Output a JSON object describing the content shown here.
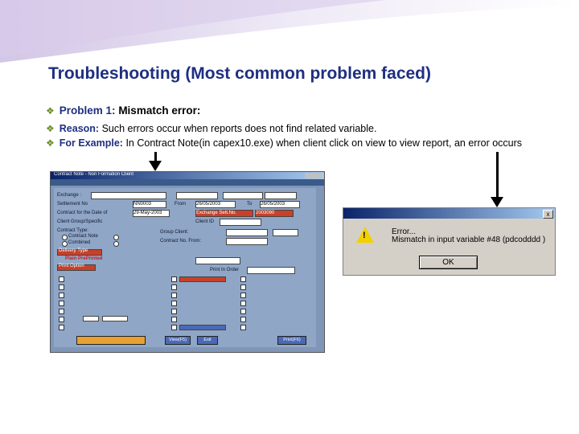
{
  "slide": {
    "title": "Troubleshooting (Most common problem faced)",
    "bullets": {
      "b1_label": "Problem 1:",
      "b1_text": "Mismatch error:",
      "b2_label": "Reason:",
      "b2_text": "Such errors occur when reports does not find related variable.",
      "b3_label": "For Example:",
      "b3_text": "In Contract Note(in capex10.exe) when client click on view to view report, an error occurs"
    }
  },
  "app_window": {
    "title": "Contract Note - Non Formation Client",
    "settlement_no": "NN0003",
    "date_from": "29-May-2003",
    "date_range_from": "26/05/2003",
    "date_range_to": "26/05/2003",
    "exchange_sett": "Exchange Sett.No.",
    "exchange_sett_value": "2003090",
    "labels": {
      "exchange": "Exchange :",
      "settlement": "Settlement No",
      "contract_date": "Contract for the Date of",
      "client_group": "Client Group/Specific",
      "contract_type": "Contract Type:",
      "group_client": "Group Client:",
      "contract_no_from": "Contract No. From:",
      "delivery_type": "Delivery Type",
      "print_option": "Print Option",
      "plain": "Plain",
      "preprinted": "PrePrinted",
      "range": "Range",
      "from": "From",
      "to": "To",
      "client_id": "Client ID",
      "contract_note": "Contract Note",
      "combined": "Combined",
      "order": "Order",
      "print_in_order": "Print In Order"
    },
    "buttons": {
      "view": "View(F5)",
      "exit": "Exit",
      "print": "Print(F6)"
    }
  },
  "error_dialog": {
    "title": "",
    "line1": "Error...",
    "line2": "Mismatch in input variable #48 (pdcodddd )",
    "ok_label": "OK",
    "close_label": "x"
  },
  "colors": {
    "title": "#1f2f80",
    "bullet_diamond": "#6b8e23",
    "arrow": "#000000"
  }
}
